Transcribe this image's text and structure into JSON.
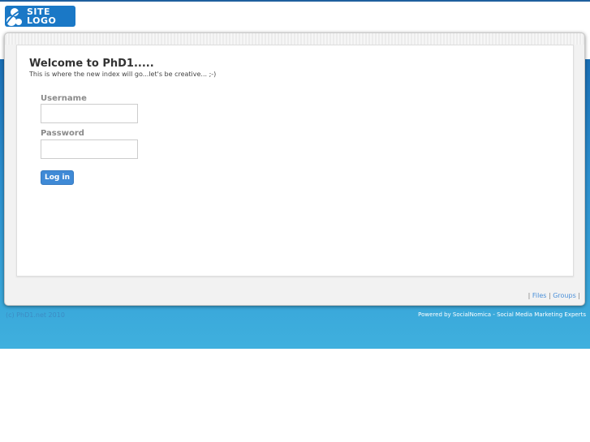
{
  "logo": {
    "line1": "SITE",
    "line2": "LOGO",
    "icon": "logo-s-icon"
  },
  "welcome": {
    "title": "Welcome to PhD1.....",
    "subtitle": "This is where the new index will go...let's be creative... ;-)"
  },
  "login": {
    "username_label": "Username",
    "username_value": "",
    "password_label": "Password",
    "password_value": "",
    "button_label": "Log in"
  },
  "panel_links": {
    "separator": "|",
    "items": [
      "Files",
      "Groups"
    ]
  },
  "footer": {
    "copyright": "(c) PhD1.net 2010",
    "powered_by": "Powered by SocialNomica - Social Media Marketing Experts"
  },
  "colors": {
    "brand_blue": "#1a78c6",
    "band_top": "#1a6fb6",
    "band_bottom": "#3fb0de",
    "button": "#3f8ad6",
    "link": "#4a90d9"
  }
}
